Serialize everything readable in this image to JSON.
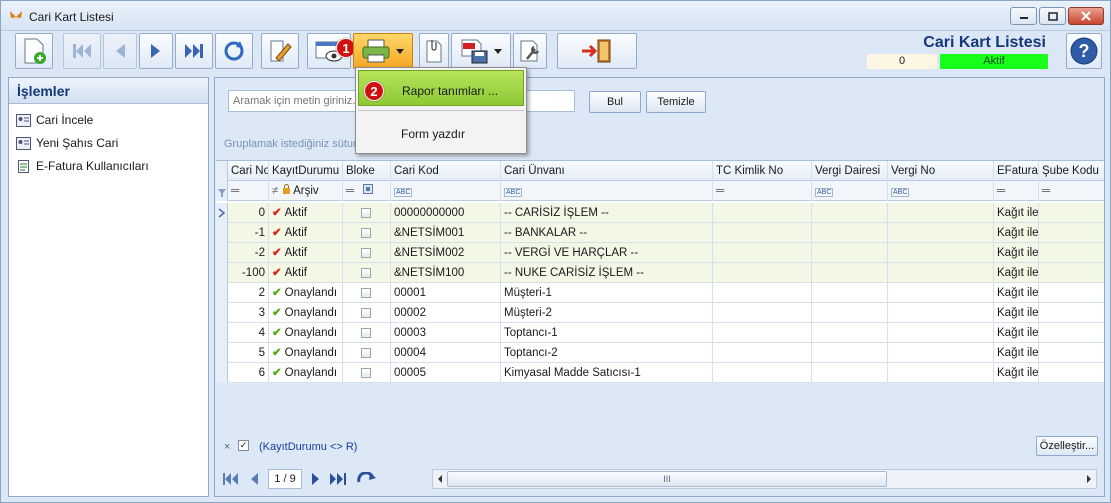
{
  "window": {
    "title": "Cari Kart Listesi"
  },
  "header": {
    "title": "Cari Kart Listesi",
    "count": "0",
    "status": "Aktif",
    "status_color": "#1aff1a"
  },
  "badges": {
    "one": "1",
    "two": "2"
  },
  "menu": {
    "items": [
      {
        "label": "Rapor tanımları ..."
      },
      {
        "label": "Form yazdır"
      }
    ]
  },
  "sidebar": {
    "title": "İşlemler",
    "items": [
      {
        "label": "Cari İncele"
      },
      {
        "label": "Yeni Şahıs Cari"
      },
      {
        "label": "E-Fatura Kullanıcıları"
      }
    ]
  },
  "search": {
    "placeholder": "Aramak için metin giriniz...",
    "find_label": "Bul",
    "clear_label": "Temizle"
  },
  "group_hint": "Gruplamak istediğiniz sütun",
  "columns": [
    "Cari No",
    "KayıtDurumu",
    "Bloke",
    "Cari Kod",
    "Cari Ünvanı",
    "TC Kimlik No",
    "Vergi Dairesi",
    "Vergi No",
    "EFatura",
    "Şube Kodu"
  ],
  "filter": {
    "kayit": "Arşiv",
    "abc": "ABC"
  },
  "rows": [
    {
      "no": "0",
      "durum": "Aktif",
      "kod": "00000000000",
      "unvan": "-- CARİSİZ İŞLEM --",
      "efatura": "Kağıt ilet"
    },
    {
      "no": "-1",
      "durum": "Aktif",
      "kod": "&NETSİM001",
      "unvan": "-- BANKALAR --",
      "efatura": "Kağıt ilet"
    },
    {
      "no": "-2",
      "durum": "Aktif",
      "kod": "&NETSİM002",
      "unvan": "-- VERGİ VE HARÇLAR --",
      "efatura": "Kağıt ilet"
    },
    {
      "no": "-100",
      "durum": "Aktif",
      "kod": "&NETSİM100",
      "unvan": "-- NUKE CARİSİZ İŞLEM --",
      "efatura": "Kağıt ilet"
    },
    {
      "no": "2",
      "durum": "Onaylandı",
      "kod": "00001",
      "unvan": "Müşteri-1",
      "efatura": "Kağıt ilet"
    },
    {
      "no": "3",
      "durum": "Onaylandı",
      "kod": "00002",
      "unvan": "Müşteri-2",
      "efatura": "Kağıt ilet"
    },
    {
      "no": "4",
      "durum": "Onaylandı",
      "kod": "00003",
      "unvan": "Toptancı-1",
      "efatura": "Kağıt ilet"
    },
    {
      "no": "5",
      "durum": "Onaylandı",
      "kod": "00004",
      "unvan": "Toptancı-2",
      "efatura": "Kağıt ilet"
    },
    {
      "no": "6",
      "durum": "Onaylandı",
      "kod": "00005",
      "unvan": "Kimyasal Madde Satıcısı-1",
      "efatura": "Kağıt ilet"
    }
  ],
  "footer": {
    "close": "×",
    "check": "✓",
    "filter_text": "(KayıtDurumu <> R)",
    "customize_label": "Özelleştir...",
    "page_label": "1 / 9",
    "scroll_grip": "III"
  }
}
